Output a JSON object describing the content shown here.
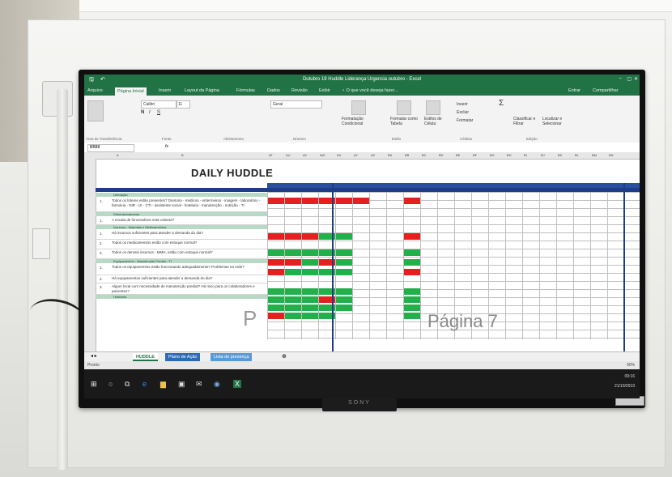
{
  "excel": {
    "window_title": "Dutubro 19 Huddle Liderança Urgencia outubro - Excel",
    "ribbon_tabs": [
      "Arquivo",
      "Página Inicial",
      "Inserir",
      "Layout da Página",
      "Fórmulas",
      "Dados",
      "Revisão",
      "Exibir",
      "♀ O que você deseja fazer..."
    ],
    "account": "Entrar",
    "share": "Compartilhar",
    "ribbon_groups": [
      "Área de Transferência",
      "Fonte",
      "Alinhamento",
      "Número",
      "Estilo",
      "Células",
      "Edição"
    ],
    "font_name": "Calibri",
    "font_size": "11",
    "number_format": "Geral",
    "styles": [
      "Formatação Condicional",
      "Formatar como Tabela",
      "Estilos de Célula"
    ],
    "cells_cmds": [
      "Inserir",
      "Excluir",
      "Formatar"
    ],
    "edit_cmds": [
      "Classificar e Filtrar",
      "Localizar e Selecionar"
    ],
    "name_box": "BB88",
    "fx": "fx",
    "col_letters": [
      "A",
      "B",
      "AT",
      "AU",
      "AV",
      "AW",
      "AX",
      "AY",
      "AZ",
      "BA",
      "BB",
      "BC",
      "BD",
      "BE",
      "BF",
      "BG",
      "BH",
      "BI",
      "BJ",
      "BK",
      "BL",
      "BM",
      "BN"
    ],
    "sheet_title": "DAILY HUDDLE",
    "sections": [
      {
        "label": "Liberação",
        "questions": [
          {
            "n": "1.",
            "text": "Todos os líderes estão presentes? Diretoria - médicos - enfermeiros - imagem - laboratório - farmácia - NIR - UI - CTI - assistente social - hotelaria - manutenção - nutrição - TI"
          }
        ]
      },
      {
        "label": "Dimensionamento",
        "questions": [
          {
            "n": "1.",
            "text": "A escala de funcionários está coberta?"
          }
        ]
      },
      {
        "label": "Insumos - Materiais e Medicamentos",
        "questions": [
          {
            "n": "1.",
            "text": "Há insumos suficientes para atender a demanda do dia?"
          },
          {
            "n": "2.",
            "text": "Todos os medicamentos estão com estoque normal?"
          },
          {
            "n": "3.",
            "text": "Todos os demais insumos - MMH, estão com estoque normal?"
          }
        ]
      },
      {
        "label": "Equipamentos - Manutenção Predial - TI",
        "questions": [
          {
            "n": "1.",
            "text": "Todos os equipamentos estão funcionando adequadamente? Problemas na rede?"
          },
          {
            "n": "2.",
            "text": "Há equipamentos suficientes para atender a demanda do dia?"
          },
          {
            "n": "3.",
            "text": "Algum local com necessidade de manutenção predial? Há risco para os colaboradores e pacientes?"
          }
        ]
      },
      {
        "label": "Hotelaria",
        "questions": []
      }
    ],
    "watermark_p": "P",
    "watermark_page": "Página 7",
    "sheet_tabs": [
      "HUDDLE",
      "Plano de Ação",
      "Lista de presença"
    ],
    "status_left": "Pronto",
    "zoom": "90%",
    "clock_time": "09:16",
    "clock_date": "21/10/2019",
    "monitor_brand": "SONY"
  }
}
